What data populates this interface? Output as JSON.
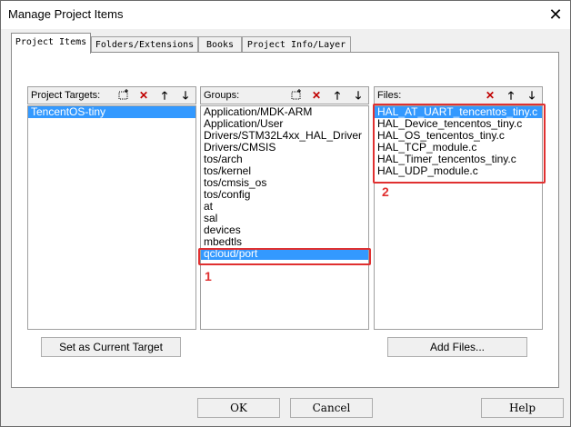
{
  "window": {
    "title": "Manage Project Items",
    "close_glyph": "✕"
  },
  "tabs": [
    {
      "label": "Project Items"
    },
    {
      "label": "Folders/Extensions"
    },
    {
      "label": "Books"
    },
    {
      "label": "Project Info/Layer"
    }
  ],
  "targets": {
    "label": "Project Targets:",
    "items": [
      "TencentOS-tiny"
    ]
  },
  "groups": {
    "label": "Groups:",
    "items": [
      "Application/MDK-ARM",
      "Application/User",
      "Drivers/STM32L4xx_HAL_Driver",
      "Drivers/CMSIS",
      "tos/arch",
      "tos/kernel",
      "tos/cmsis_os",
      "tos/config",
      "at",
      "sal",
      "devices",
      "mbedtls",
      "qcloud/port"
    ]
  },
  "files": {
    "label": "Files:",
    "items": [
      "HAL_AT_UART_tencentos_tiny.c",
      "HAL_Device_tencentos_tiny.c",
      "HAL_OS_tencentos_tiny.c",
      "HAL_TCP_module.c",
      "HAL_Timer_tencentos_tiny.c",
      "HAL_UDP_module.c"
    ]
  },
  "annotations": {
    "one": "1",
    "two": "2"
  },
  "buttons": {
    "set_current": "Set as Current Target",
    "add_files": "Add Files...",
    "ok": "OK",
    "cancel": "Cancel",
    "help": "Help"
  },
  "icons": {
    "new": "new-folder-icon",
    "delete": "delete-icon",
    "up": "move-up-icon",
    "down": "move-down-icon"
  },
  "colors": {
    "selection": "#3399ff",
    "annotation": "#e03030"
  }
}
